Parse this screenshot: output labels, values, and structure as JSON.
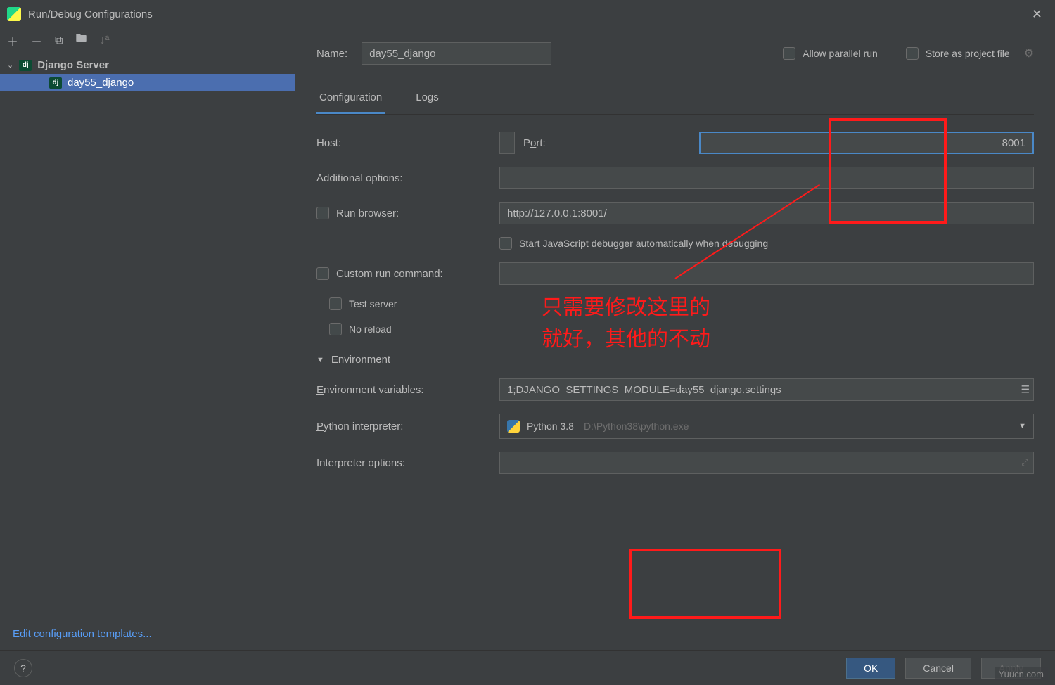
{
  "title": "Run/Debug Configurations",
  "toolbar_icons": [
    "+",
    "−",
    "⧉",
    "📁",
    "↓ᴬ"
  ],
  "tree": {
    "group_label": "Django Server",
    "group_icon": "dj",
    "item_label": "day55_django",
    "item_icon": "dj"
  },
  "edit_templates": "Edit configuration templates...",
  "top": {
    "name_label": "Name:",
    "name_value": "day55_django",
    "allow_parallel": "Allow parallel run",
    "store_project": "Store as project file"
  },
  "tabs": {
    "configuration": "Configuration",
    "logs": "Logs"
  },
  "form": {
    "host_label": "Host:",
    "host_value": "",
    "port_label": "Port:",
    "port_value": "8001",
    "additional_label": "Additional options:",
    "additional_value": "",
    "run_browser_label": "Run browser:",
    "run_browser_value": "http://127.0.0.1:8001/",
    "js_debugger": "Start JavaScript debugger automatically when debugging",
    "custom_run_label": "Custom run command:",
    "test_server": "Test server",
    "no_reload": "No reload",
    "env_section": "Environment",
    "env_vars_label": "Environment variables:",
    "env_vars_value": "1;DJANGO_SETTINGS_MODULE=day55_django.settings",
    "python_interp_label": "Python interpreter:",
    "python_interp_name": "Python 3.8",
    "python_interp_path": "D:\\Python38\\python.exe",
    "interp_options_label": "Interpreter options:",
    "interp_options_value": ""
  },
  "buttons": {
    "ok": "OK",
    "cancel": "Cancel",
    "apply": "Apply",
    "help": "?"
  },
  "annotation": {
    "line1": "只需要修改这里的",
    "line2": "就好，其他的不动"
  },
  "watermark": "Yuucn.com"
}
